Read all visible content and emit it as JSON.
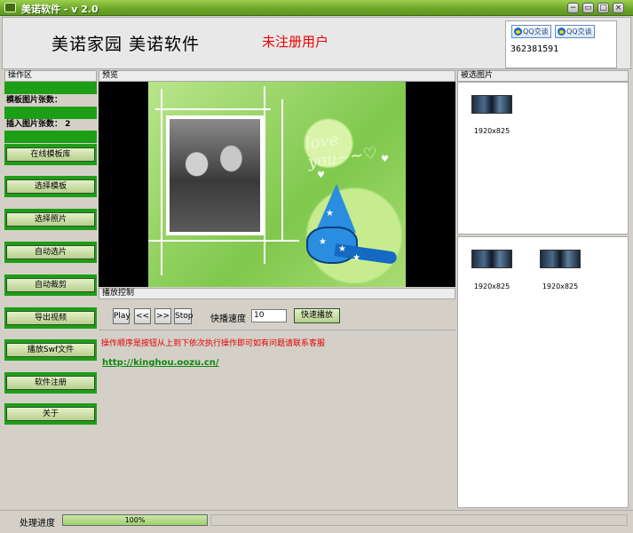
{
  "window": {
    "title": "美诺软件 - v 2.0",
    "min_label": "−",
    "max_label": "□",
    "restore_label": "▭",
    "close_label": "×"
  },
  "header": {
    "brand": "美诺家园 美诺软件",
    "unregistered": "未注册用户",
    "qq_button_1": "QQ交谈",
    "qq_button_2": "QQ交谈",
    "qq_number": "362381591"
  },
  "panels": {
    "operation": "操作区",
    "preview": "预览",
    "selected": "被选图片",
    "playback": "播放控制"
  },
  "operation": {
    "template_count": "模板图片张数：",
    "insert_count": "插入图片张数： 2",
    "buttons": [
      "在线模板库",
      "选择模板",
      "选择照片",
      "自动选片",
      "自动裁剪",
      "导出视频",
      "播放Swf文件",
      "软件注册",
      "关于"
    ]
  },
  "preview": {
    "overlay_text": "love you~~♡"
  },
  "playback": {
    "play": "Play",
    "prev": "<<",
    "next": ">>",
    "stop": "Stop",
    "speed_label": "快播速度",
    "speed_value": "10",
    "fast_play": "快速播放"
  },
  "info": {
    "instruction": "操作顺序是按钮从上到下依次执行操作即可如有问题请联系客服",
    "link": "http://kinghou.oozu.cn/"
  },
  "selected_images": {
    "top": [
      {
        "label": "1920x825"
      }
    ],
    "bottom": [
      {
        "label": "1920x825"
      },
      {
        "label": "1920x825"
      }
    ]
  },
  "status": {
    "label": "处理进度",
    "progress": 1.0,
    "progress_text": "100%"
  }
}
